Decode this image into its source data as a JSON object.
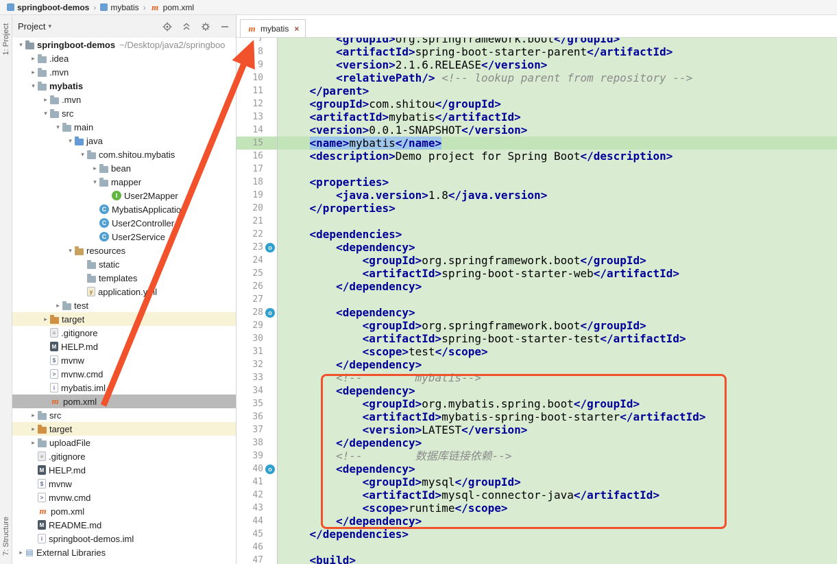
{
  "breadcrumb": {
    "separator": "›",
    "items": [
      {
        "label": "springboot-demos",
        "icon": "module"
      },
      {
        "label": "mybatis",
        "icon": "module"
      },
      {
        "label": "pom.xml",
        "icon": "maven"
      }
    ]
  },
  "left_strip": {
    "top_label": "1: Project",
    "bottom_label": "7: Structure"
  },
  "project_panel": {
    "title": "Project",
    "caret": "▾",
    "header_icons": [
      "locate-icon",
      "collapse-all-icon",
      "settings-icon",
      "hide-icon"
    ],
    "tree": [
      {
        "label": "springboot-demos",
        "hint": "~/Desktop/java2/springboo",
        "indent": 0,
        "icon": "folder-root",
        "arrow": "down",
        "bold": true
      },
      {
        "label": ".idea",
        "indent": 1,
        "icon": "folder",
        "arrow": "right"
      },
      {
        "label": ".mvn",
        "indent": 1,
        "icon": "folder",
        "arrow": "right"
      },
      {
        "label": "mybatis",
        "indent": 1,
        "icon": "folder",
        "arrow": "down",
        "bold": true
      },
      {
        "label": ".mvn",
        "indent": 2,
        "icon": "folder",
        "arrow": "right"
      },
      {
        "label": "src",
        "indent": 2,
        "icon": "folder",
        "arrow": "down"
      },
      {
        "label": "main",
        "indent": 3,
        "icon": "folder",
        "arrow": "down"
      },
      {
        "label": "java",
        "indent": 4,
        "icon": "folder-src",
        "arrow": "down"
      },
      {
        "label": "com.shitou.mybatis",
        "indent": 5,
        "icon": "package",
        "arrow": "down"
      },
      {
        "label": "bean",
        "indent": 6,
        "icon": "package",
        "arrow": "right"
      },
      {
        "label": "mapper",
        "indent": 6,
        "icon": "package",
        "arrow": "down"
      },
      {
        "label": "User2Mapper",
        "indent": 7,
        "icon": "interface"
      },
      {
        "label": "MybatisApplication",
        "indent": 6,
        "icon": "class"
      },
      {
        "label": "User2Controller",
        "indent": 6,
        "icon": "class"
      },
      {
        "label": "User2Service",
        "indent": 6,
        "icon": "class"
      },
      {
        "label": "resources",
        "indent": 4,
        "icon": "folder-res",
        "arrow": "down"
      },
      {
        "label": "static",
        "indent": 5,
        "icon": "folder"
      },
      {
        "label": "templates",
        "indent": 5,
        "icon": "folder"
      },
      {
        "label": "application.yml",
        "indent": 5,
        "icon": "file-yml"
      },
      {
        "label": "test",
        "indent": 3,
        "icon": "folder",
        "arrow": "right"
      },
      {
        "label": "target",
        "indent": 2,
        "icon": "folder-excluded",
        "arrow": "right",
        "row": "excluded"
      },
      {
        "label": ".gitignore",
        "indent": 2,
        "icon": "file-git"
      },
      {
        "label": "HELP.md",
        "indent": 2,
        "icon": "file-md"
      },
      {
        "label": "mvnw",
        "indent": 2,
        "icon": "file-sh"
      },
      {
        "label": "mvnw.cmd",
        "indent": 2,
        "icon": "file-cmd"
      },
      {
        "label": "mybatis.iml",
        "indent": 2,
        "icon": "file-iml"
      },
      {
        "label": "pom.xml",
        "indent": 2,
        "icon": "maven",
        "selected": true
      },
      {
        "label": "src",
        "indent": 1,
        "icon": "folder",
        "arrow": "right"
      },
      {
        "label": "target",
        "indent": 1,
        "icon": "folder-excluded",
        "arrow": "right",
        "row": "excluded"
      },
      {
        "label": "uploadFile",
        "indent": 1,
        "icon": "folder",
        "arrow": "right"
      },
      {
        "label": ".gitignore",
        "indent": 1,
        "icon": "file-git"
      },
      {
        "label": "HELP.md",
        "indent": 1,
        "icon": "file-md"
      },
      {
        "label": "mvnw",
        "indent": 1,
        "icon": "file-sh"
      },
      {
        "label": "mvnw.cmd",
        "indent": 1,
        "icon": "file-cmd"
      },
      {
        "label": "pom.xml",
        "indent": 1,
        "icon": "maven"
      },
      {
        "label": "README.md",
        "indent": 1,
        "icon": "file-md"
      },
      {
        "label": "springboot-demos.iml",
        "indent": 1,
        "icon": "file-iml"
      },
      {
        "label": "External Libraries",
        "indent": 0,
        "icon": "libraries",
        "arrow": "right"
      }
    ]
  },
  "editor": {
    "tab": {
      "label": "mybatis",
      "icon": "maven",
      "icon_glyph": "m",
      "close_icon": "×"
    },
    "lines": [
      {
        "n": 7,
        "seg": [
          [
            "t",
            "        <groupId>"
          ],
          [
            "p",
            "org.springframework.boot"
          ],
          [
            "t",
            "</groupId>"
          ]
        ]
      },
      {
        "n": 8,
        "seg": [
          [
            "t",
            "        <artifactId>"
          ],
          [
            "p",
            "spring-boot-starter-parent"
          ],
          [
            "t",
            "</artifactId>"
          ]
        ]
      },
      {
        "n": 9,
        "seg": [
          [
            "t",
            "        <version>"
          ],
          [
            "p",
            "2.1.6.RELEASE"
          ],
          [
            "t",
            "</version>"
          ]
        ]
      },
      {
        "n": 10,
        "seg": [
          [
            "t",
            "        <relativePath/>"
          ],
          [
            "p",
            " "
          ],
          [
            "c",
            "<!-- lookup parent from repository -->"
          ]
        ]
      },
      {
        "n": 11,
        "seg": [
          [
            "t",
            "    </parent>"
          ]
        ]
      },
      {
        "n": 12,
        "seg": [
          [
            "t",
            "    <groupId>"
          ],
          [
            "p",
            "com.shitou"
          ],
          [
            "t",
            "</groupId>"
          ]
        ]
      },
      {
        "n": 13,
        "seg": [
          [
            "t",
            "    <artifactId>"
          ],
          [
            "p",
            "mybatis"
          ],
          [
            "t",
            "</artifactId>"
          ]
        ]
      },
      {
        "n": 14,
        "seg": [
          [
            "t",
            "    <version>"
          ],
          [
            "p",
            "0.0.1-SNAPSHOT"
          ],
          [
            "t",
            "</version>"
          ]
        ]
      },
      {
        "n": 15,
        "hl": true,
        "seg": [
          [
            "p",
            "    "
          ],
          [
            "t!",
            "<name>"
          ],
          [
            "p!",
            "mybatis"
          ],
          [
            "t!",
            "</name>"
          ]
        ]
      },
      {
        "n": 16,
        "seg": [
          [
            "t",
            "    <description>"
          ],
          [
            "p",
            "Demo project for Spring Boot"
          ],
          [
            "t",
            "</description>"
          ]
        ]
      },
      {
        "n": 17,
        "seg": []
      },
      {
        "n": 18,
        "seg": [
          [
            "t",
            "    <properties>"
          ]
        ]
      },
      {
        "n": 19,
        "seg": [
          [
            "t",
            "        <java.version>"
          ],
          [
            "p",
            "1.8"
          ],
          [
            "t",
            "</java.version>"
          ]
        ]
      },
      {
        "n": 20,
        "seg": [
          [
            "t",
            "    </properties>"
          ]
        ]
      },
      {
        "n": 21,
        "seg": []
      },
      {
        "n": 22,
        "seg": [
          [
            "t",
            "    <dependencies>"
          ]
        ]
      },
      {
        "n": 23,
        "icon": true,
        "seg": [
          [
            "t",
            "        <dependency>"
          ]
        ]
      },
      {
        "n": 24,
        "seg": [
          [
            "t",
            "            <groupId>"
          ],
          [
            "p",
            "org.springframework.boot"
          ],
          [
            "t",
            "</groupId>"
          ]
        ]
      },
      {
        "n": 25,
        "seg": [
          [
            "t",
            "            <artifactId>"
          ],
          [
            "p",
            "spring-boot-starter-web"
          ],
          [
            "t",
            "</artifactId>"
          ]
        ]
      },
      {
        "n": 26,
        "seg": [
          [
            "t",
            "        </dependency>"
          ]
        ]
      },
      {
        "n": 27,
        "seg": []
      },
      {
        "n": 28,
        "icon": true,
        "seg": [
          [
            "t",
            "        <dependency>"
          ]
        ]
      },
      {
        "n": 29,
        "seg": [
          [
            "t",
            "            <groupId>"
          ],
          [
            "p",
            "org.springframework.boot"
          ],
          [
            "t",
            "</groupId>"
          ]
        ]
      },
      {
        "n": 30,
        "seg": [
          [
            "t",
            "            <artifactId>"
          ],
          [
            "p",
            "spring-boot-starter-test"
          ],
          [
            "t",
            "</artifactId>"
          ]
        ]
      },
      {
        "n": 31,
        "seg": [
          [
            "t",
            "            <scope>"
          ],
          [
            "p",
            "test"
          ],
          [
            "t",
            "</scope>"
          ]
        ]
      },
      {
        "n": 32,
        "seg": [
          [
            "t",
            "        </dependency>"
          ]
        ]
      },
      {
        "n": 33,
        "seg": [
          [
            "c",
            "        <!--        mybatis-->"
          ]
        ]
      },
      {
        "n": 34,
        "seg": [
          [
            "t",
            "        <dependency>"
          ]
        ]
      },
      {
        "n": 35,
        "seg": [
          [
            "t",
            "            <groupId>"
          ],
          [
            "p",
            "org.mybatis.spring.boot"
          ],
          [
            "t",
            "</groupId>"
          ]
        ]
      },
      {
        "n": 36,
        "seg": [
          [
            "t",
            "            <artifactId>"
          ],
          [
            "p",
            "mybatis-spring-boot-starter"
          ],
          [
            "t",
            "</artifactId>"
          ]
        ]
      },
      {
        "n": 37,
        "seg": [
          [
            "t",
            "            <version>"
          ],
          [
            "p",
            "LATEST"
          ],
          [
            "t",
            "</version>"
          ]
        ]
      },
      {
        "n": 38,
        "seg": [
          [
            "t",
            "        </dependency>"
          ]
        ]
      },
      {
        "n": 39,
        "seg": [
          [
            "c",
            "        <!--        数据库链接依赖-->"
          ]
        ]
      },
      {
        "n": 40,
        "icon": true,
        "seg": [
          [
            "t",
            "        <dependency>"
          ]
        ]
      },
      {
        "n": 41,
        "seg": [
          [
            "t",
            "            <groupId>"
          ],
          [
            "p",
            "mysql"
          ],
          [
            "t",
            "</groupId>"
          ]
        ]
      },
      {
        "n": 42,
        "seg": [
          [
            "t",
            "            <artifactId>"
          ],
          [
            "p",
            "mysql-connector-java"
          ],
          [
            "t",
            "</artifactId>"
          ]
        ]
      },
      {
        "n": 43,
        "seg": [
          [
            "t",
            "            <scope>"
          ],
          [
            "p",
            "runtime"
          ],
          [
            "t",
            "</scope>"
          ]
        ]
      },
      {
        "n": 44,
        "seg": [
          [
            "t",
            "        </dependency>"
          ]
        ]
      },
      {
        "n": 45,
        "seg": [
          [
            "t",
            "    </dependencies>"
          ]
        ]
      },
      {
        "n": 46,
        "seg": []
      },
      {
        "n": 47,
        "seg": [
          [
            "t",
            "    <build>"
          ]
        ]
      }
    ]
  },
  "annotations": {
    "arrow_color": "#f1512b",
    "box_color": "#f1512b"
  },
  "colors": {
    "editor_background": "#d9ecd2",
    "line_highlight": "#c3e3b8",
    "selection": "#9ec7ea",
    "tag": "#000099",
    "comment": "#8a8a8a",
    "excluded_row": "#f8f2d7",
    "selected_row": "#b9b9b9"
  }
}
